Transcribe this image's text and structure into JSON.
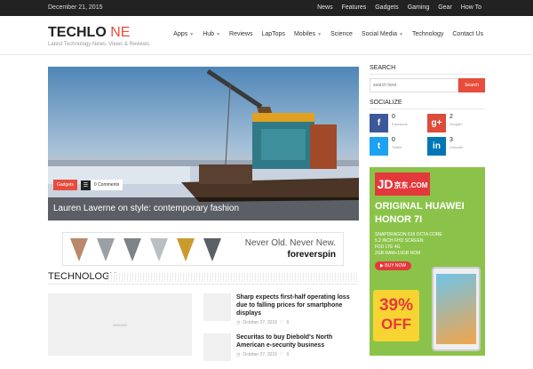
{
  "topbar": {
    "date": "December 21, 2015",
    "links": [
      "News",
      "Features",
      "Gadgets",
      "Gaming",
      "Gear",
      "How To"
    ]
  },
  "header": {
    "logo_main": "TECHLO",
    "logo_accent": "NE",
    "tagline": "Latest Technology News, Views & Reviews",
    "nav": [
      {
        "label": "Apps",
        "dropdown": true
      },
      {
        "label": "Hub",
        "dropdown": true
      },
      {
        "label": "Reviews",
        "dropdown": false
      },
      {
        "label": "LapTops",
        "dropdown": false
      },
      {
        "label": "Mobiles",
        "dropdown": true
      },
      {
        "label": "Science",
        "dropdown": false
      },
      {
        "label": "Social Media",
        "dropdown": true
      },
      {
        "label": "Technology",
        "dropdown": false
      },
      {
        "label": "Contact Us",
        "dropdown": false
      }
    ]
  },
  "hero": {
    "category": "Gadgets",
    "comments": "0 Comments",
    "caption": "Lauren Laverne on style: contemporary fashion"
  },
  "ad_banner": {
    "line1": "Never Old. Never New.",
    "line2": "foreverspin"
  },
  "section": {
    "title": "TECHNOLOGY",
    "big_thumb_text": "240×160",
    "posts": [
      {
        "title": "Sharp expects first-half operating loss due to falling prices for smartphone displays",
        "date": "October 27, 2015",
        "comments": "0"
      },
      {
        "title": "Securitas to buy Diebold's North American e-security business",
        "date": "October 27, 2015",
        "comments": "0"
      }
    ]
  },
  "sidebar": {
    "search_heading": "SEARCH",
    "search_placeholder": "search here",
    "search_button": "Search",
    "socialize_heading": "SOCIALIZE",
    "social": [
      {
        "icon": "facebook-icon",
        "glyph": "f",
        "count": "0",
        "label": "Facebook",
        "color": "#3b5998"
      },
      {
        "icon": "googleplus-icon",
        "glyph": "g+",
        "count": "2",
        "label": "Google+",
        "color": "#dd4b39"
      },
      {
        "icon": "twitter-icon",
        "glyph": "t",
        "count": "0",
        "label": "Twitter",
        "color": "#1da1f2"
      },
      {
        "icon": "linkedin-icon",
        "glyph": "in",
        "count": "3",
        "label": "LinkedIn",
        "color": "#0077b5"
      }
    ]
  },
  "side_ad": {
    "brand": "JD",
    "brand_suffix": "京东",
    "brand_com": ".COM",
    "line1": "ORIGINAL HUAWEI",
    "line2": "HONOR 7I",
    "specs": [
      "SNAPDRAGON 616 OCTA CORE",
      "5.2 INCH FHD SCREEN",
      "FDD LTE 4G",
      "2GB RAM+16GB ROM"
    ],
    "buy": "BUY NOW",
    "percent": "39%",
    "off": "OFF"
  },
  "colors": {
    "accent": "#e74c3c",
    "topbar": "#222222",
    "ad_green": "#8bc34a"
  }
}
